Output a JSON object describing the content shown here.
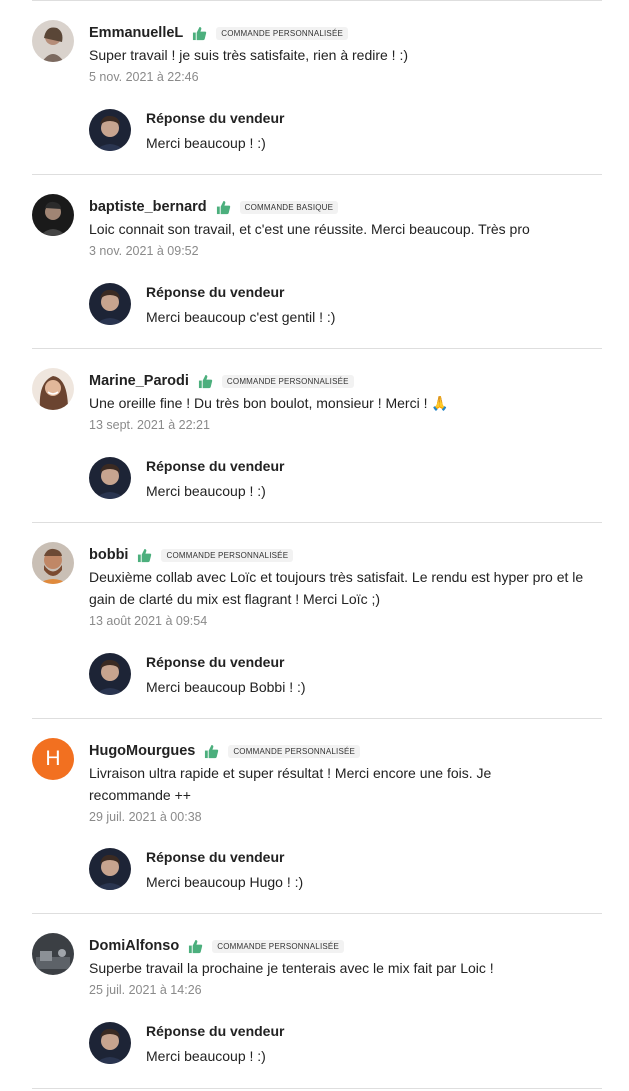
{
  "reviews": [
    {
      "username": "EmmanuelleL",
      "badge": "COMMANDE PERSONNALISÉE",
      "comment": "Super travail ! je suis très satisfaite, rien à redire ! :)",
      "date": "5 nov. 2021 à 22:46",
      "reply_title": "Réponse du vendeur",
      "reply_text": "Merci beaucoup ! :)"
    },
    {
      "username": "baptiste_bernard",
      "badge": "COMMANDE BASIQUE",
      "comment": "Loic connait son travail, et c'est une réussite. Merci beaucoup. Très pro",
      "date": "3 nov. 2021 à 09:52",
      "reply_title": "Réponse du vendeur",
      "reply_text": "Merci beaucoup c'est gentil ! :)"
    },
    {
      "username": "Marine_Parodi",
      "badge": "COMMANDE PERSONNALISÉE",
      "comment": "Une oreille fine ! Du très bon boulot, monsieur ! Merci ! 🙏",
      "date": "13 sept. 2021 à 22:21",
      "reply_title": "Réponse du vendeur",
      "reply_text": "Merci beaucoup ! :)"
    },
    {
      "username": "bobbi",
      "badge": "COMMANDE PERSONNALISÉE",
      "comment": "Deuxième collab avec Loïc et toujours très satisfait. Le rendu est hyper pro et le gain de clarté du mix est flagrant ! Merci Loïc ;)",
      "date": "13 août 2021 à 09:54",
      "reply_title": "Réponse du vendeur",
      "reply_text": "Merci beaucoup Bobbi ! :)"
    },
    {
      "username": "HugoMourgues",
      "avatar_letter": "H",
      "badge": "COMMANDE PERSONNALISÉE",
      "comment": "Livraison ultra rapide et super résultat ! Merci encore une fois. Je recommande ++",
      "date": "29 juil. 2021 à 00:38",
      "reply_title": "Réponse du vendeur",
      "reply_text": "Merci beaucoup Hugo ! :)"
    },
    {
      "username": "DomiAlfonso",
      "badge": "COMMANDE PERSONNALISÉE",
      "comment": "Superbe travail la prochaine je tenterais avec le mix fait par Loic !",
      "date": "25 juil. 2021 à 14:26",
      "reply_title": "Réponse du vendeur",
      "reply_text": "Merci beaucoup ! :)"
    }
  ],
  "colors": {
    "thumb_green": "#4caf7d",
    "letter_avatar": "#f27020",
    "date_gray": "#8a8a8a",
    "divider": "#dedede"
  },
  "icons": {
    "thumb": "thumbs-up-icon",
    "seller_avatar": "seller-avatar"
  }
}
